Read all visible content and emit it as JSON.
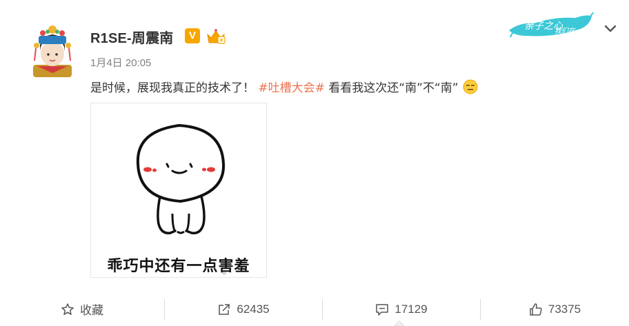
{
  "post": {
    "username": "R1SE-周震南",
    "verified_badge": "V",
    "timestamp": "1月4日 20:05",
    "text_before": "是时候，展现我真正的技术了！",
    "hashtag": "#吐槽大会#",
    "text_after": "看看我这次还“南”不“南”",
    "emoji": "expressionless-face-emoji",
    "image_caption": "乖巧中还有一点害羞"
  },
  "brand_logo_text": "亲子之心 我们在",
  "toolbar": {
    "favorite_label": "收藏",
    "repost_count": "62435",
    "comment_count": "17129",
    "like_count": "73375"
  },
  "icons": {
    "favorite": "star-outline-icon",
    "repost": "share-arrow-icon",
    "comment": "comment-bubble-icon",
    "like": "thumbs-up-icon",
    "menu": "chevron-down-icon"
  },
  "colors": {
    "hashtag": "#eb7350",
    "verified": "#f7a600",
    "brand": "#3cc8d6",
    "text": "#333333",
    "muted": "#808080"
  }
}
